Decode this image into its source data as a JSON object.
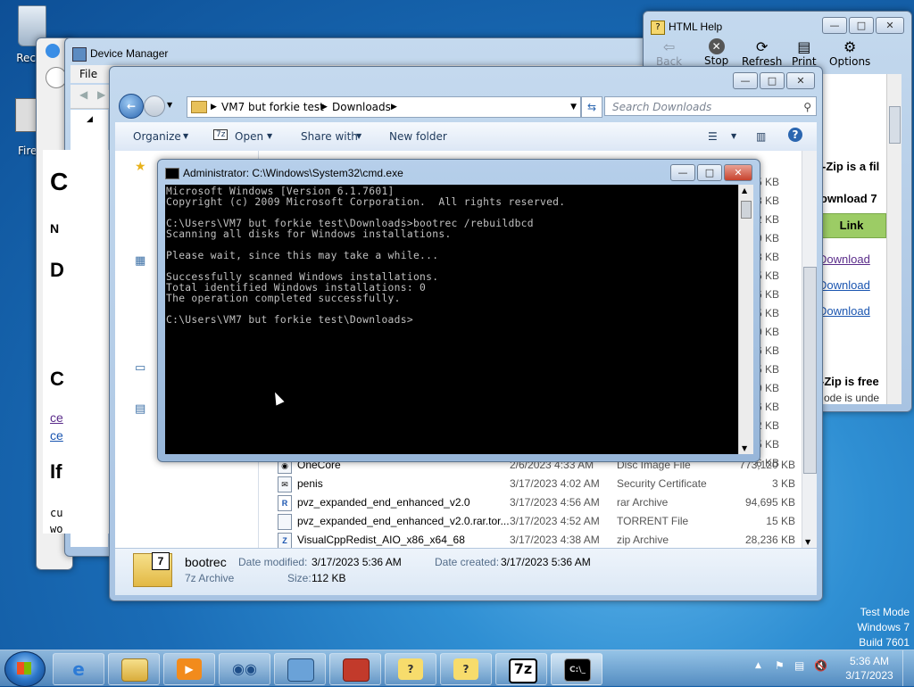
{
  "desktop": {
    "recycle_label": "Recyc",
    "fire_label": "Fire"
  },
  "devmgr": {
    "title": "Device Manager",
    "menu_file": "File"
  },
  "bg_window_letters": [
    "C",
    "N",
    "D",
    "C",
    "If"
  ],
  "bg_window_links": [
    "ce",
    "ce"
  ],
  "bg_window_small": [
    "cu",
    "wo"
  ],
  "help": {
    "title": "HTML Help",
    "tools": [
      "Back",
      "Stop",
      "Refresh",
      "Print",
      "Options"
    ],
    "text1": "-Zip is a fil",
    "text2": "ownload 7",
    "link_header": "Link",
    "links": [
      "Download",
      "Download",
      "Download"
    ],
    "text3": "-Zip is free",
    "text4": "ode is unde"
  },
  "explorer": {
    "breadcrumb": [
      "VM7 but forkie test",
      "Downloads"
    ],
    "search_placeholder": "Search Downloads",
    "cmds": {
      "organize": "Organize",
      "open": "Open",
      "share": "Share with",
      "new_folder": "New folder"
    },
    "partial_sizes": [
      "5 KB",
      "3 KB",
      "2 KB",
      "0 KB",
      "8 KB",
      "5 KB",
      "6 KB",
      "5 KB",
      "0 KB",
      "6 KB",
      "5 KB",
      "0 KB",
      "6 KB",
      "2 KB",
      "5 KB",
      "6 KB"
    ],
    "files": [
      {
        "name": "OneCore",
        "date": "2/6/2023 4:33 AM",
        "type": "Disc Image File",
        "size": "773,120 KB",
        "icon": "disc-icon"
      },
      {
        "name": "penis",
        "date": "3/17/2023 4:02 AM",
        "type": "Security Certificate",
        "size": "3 KB",
        "icon": "certificate-icon"
      },
      {
        "name": "pvz_expanded_end_enhanced_v2.0",
        "date": "3/17/2023 4:56 AM",
        "type": "rar Archive",
        "size": "94,695 KB",
        "icon": "rar-icon"
      },
      {
        "name": "pvz_expanded_end_enhanced_v2.0.rar.tor...",
        "date": "3/17/2023 4:52 AM",
        "type": "TORRENT File",
        "size": "15 KB",
        "icon": "file-icon"
      },
      {
        "name": "VisualCppRedist_AIO_x86_x64_68",
        "date": "3/17/2023 4:38 AM",
        "type": "zip Archive",
        "size": "28,236 KB",
        "icon": "zip-icon"
      }
    ],
    "details": {
      "name": "bootrec",
      "kind": "7z Archive",
      "modified_label": "Date modified:",
      "modified": "3/17/2023 5:36 AM",
      "created_label": "Date created:",
      "created": "3/17/2023 5:36 AM",
      "size_label": "Size:",
      "size": "112 KB"
    }
  },
  "cmd": {
    "title": "Administrator: C:\\Windows\\System32\\cmd.exe",
    "output": "Microsoft Windows [Version 6.1.7601]\nCopyright (c) 2009 Microsoft Corporation.  All rights reserved.\n\nC:\\Users\\VM7 but forkie test\\Downloads>bootrec /rebuildbcd\nScanning all disks for Windows installations.\n\nPlease wait, since this may take a while...\n\nSuccessfully scanned Windows installations.\nTotal identified Windows installations: 0\nThe operation completed successfully.\n\nC:\\Users\\VM7 but forkie test\\Downloads>"
  },
  "watermark": [
    "Test Mode",
    "Windows 7",
    "Build 7601"
  ],
  "clock": {
    "time": "5:36 AM",
    "date": "3/17/2023"
  },
  "taskbar": [
    "Internet Explorer",
    "Windows Explorer",
    "Windows Media Player",
    "Control Panel",
    "Device Manager",
    "Toolbox",
    "HTML Help",
    "HTML Help",
    "7-Zip",
    "Command Prompt"
  ],
  "taskbar_labels": {
    "seven_zip": "7z",
    "cmd": "C:\\_"
  }
}
